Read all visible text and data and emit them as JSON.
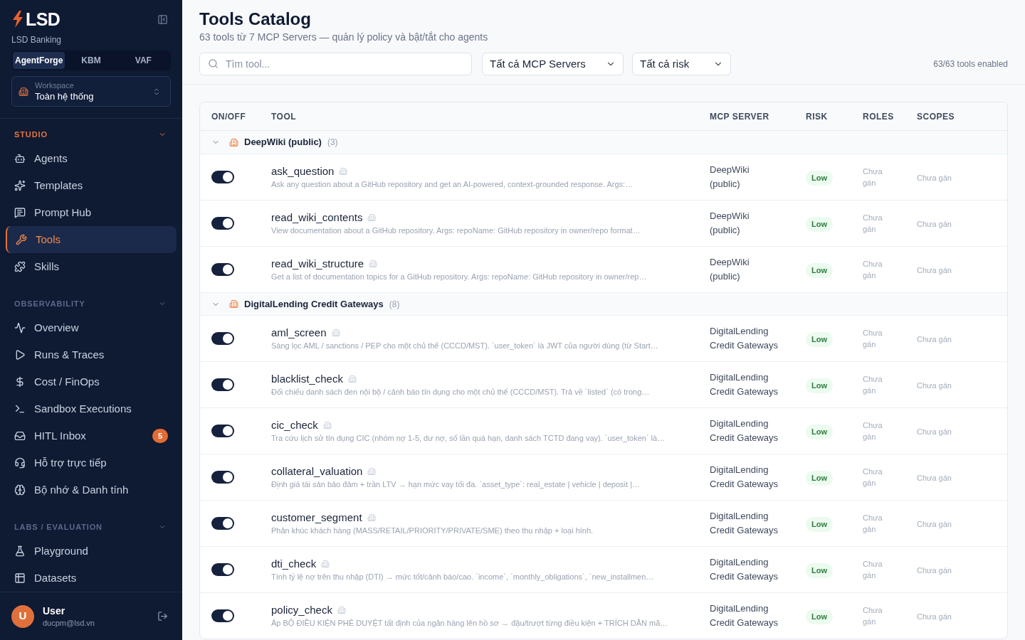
{
  "sidebar": {
    "logo": {
      "text": "LSD"
    },
    "org": "LSD Banking",
    "app_tabs": [
      {
        "label": "AgentForge",
        "selected": true
      },
      {
        "label": "KBM",
        "selected": false
      },
      {
        "label": "VAF",
        "selected": false
      }
    ],
    "workspace": {
      "label": "Workspace",
      "value": "Toàn hệ thống"
    },
    "sections": [
      {
        "title": "STUDIO",
        "active": true,
        "expanded": true,
        "items": [
          {
            "label": "Agents",
            "selected": false
          },
          {
            "label": "Templates",
            "selected": false
          },
          {
            "label": "Prompt Hub",
            "selected": false
          },
          {
            "label": "Tools",
            "selected": true
          },
          {
            "label": "Skills",
            "selected": false
          }
        ]
      },
      {
        "title": "OBSERVABILITY",
        "active": false,
        "expanded": true,
        "items": [
          {
            "label": "Overview",
            "selected": false
          },
          {
            "label": "Runs & Traces",
            "selected": false
          },
          {
            "label": "Cost / FinOps",
            "selected": false
          },
          {
            "label": "Sandbox Executions",
            "selected": false
          },
          {
            "label": "HITL Inbox",
            "selected": false,
            "badge": "5"
          },
          {
            "label": "Hỗ trợ trực tiếp",
            "selected": false
          },
          {
            "label": "Bộ nhớ & Danh tính",
            "selected": false
          }
        ]
      },
      {
        "title": "LABS / EVALUATION",
        "active": false,
        "expanded": true,
        "items": [
          {
            "label": "Playground",
            "selected": false
          },
          {
            "label": "Datasets",
            "selected": false
          }
        ]
      }
    ],
    "user": {
      "avatar": "U",
      "name": "User",
      "email": "ducpm@lsd.vn"
    }
  },
  "header": {
    "title": "Tools Catalog",
    "subtitle": "63 tools từ 7 MCP Servers — quản lý policy và bật/tắt cho agents"
  },
  "filters": {
    "search": {
      "placeholder": "Tìm tool..."
    },
    "dropdowns": [
      {
        "value": "Tất cả MCP Servers"
      },
      {
        "value": "Tất cả risk"
      }
    ],
    "summary": "63/63 tools enabled"
  },
  "table": {
    "columns": [
      "ON/OFF",
      "TOOL",
      "MCP SERVER",
      "RISK",
      "ROLES",
      "SCOPES"
    ],
    "groups": [
      {
        "name": "DeepWiki (public)",
        "count": "(3)",
        "expanded": true,
        "tools": [
          {
            "enabled": true,
            "name": "ask_question",
            "description": "Ask any question about a GitHub repository and get an AI-powered, context-grounded response. Args:…",
            "server": "DeepWiki (public)",
            "risk": {
              "label": "Low",
              "kind": "low"
            },
            "roles": "Chưa gán",
            "scopes": "Chưa gán"
          },
          {
            "enabled": true,
            "name": "read_wiki_contents",
            "description": "View documentation about a GitHub repository. Args: repoName: GitHub repository in owner/repo format…",
            "server": "DeepWiki (public)",
            "risk": {
              "label": "Low",
              "kind": "low"
            },
            "roles": "Chưa gán",
            "scopes": "Chưa gán"
          },
          {
            "enabled": true,
            "name": "read_wiki_structure",
            "description": "Get a list of documentation topics for a GitHub repository. Args: repoName: GitHub repository in owner/rep…",
            "server": "DeepWiki (public)",
            "risk": {
              "label": "Low",
              "kind": "low"
            },
            "roles": "Chưa gán",
            "scopes": "Chưa gán"
          }
        ]
      },
      {
        "name": "DigitalLending Credit Gateways",
        "count": "(8)",
        "expanded": true,
        "tools": [
          {
            "enabled": true,
            "name": "aml_screen",
            "description": "Sàng lọc AML / sanctions / PEP cho một chủ thể (CCCD/MST). `user_token` là JWT của người dùng (từ Start…",
            "server": "DigitalLending Credit Gateways",
            "risk": {
              "label": "Low",
              "kind": "low"
            },
            "roles": "Chưa gán",
            "scopes": "Chưa gán"
          },
          {
            "enabled": true,
            "name": "blacklist_check",
            "description": "Đối chiếu danh sách đen nội bộ / cảnh báo tín dụng cho một chủ thể (CCCD/MST). Trả về `listed` (có trong…",
            "server": "DigitalLending Credit Gateways",
            "risk": {
              "label": "Low",
              "kind": "low"
            },
            "roles": "Chưa gán",
            "scopes": "Chưa gán"
          },
          {
            "enabled": true,
            "name": "cic_check",
            "description": "Tra cứu lịch sử tín dụng CIC (nhóm nợ 1-5, dư nợ, số lần quá hạn, danh sách TCTD đang vay). `user_token` là…",
            "server": "DigitalLending Credit Gateways",
            "risk": {
              "label": "Low",
              "kind": "low"
            },
            "roles": "Chưa gán",
            "scopes": "Chưa gán"
          },
          {
            "enabled": true,
            "name": "collateral_valuation",
            "description": "Định giá tài sản bảo đảm + trần LTV → hạn mức vay tối đa. `asset_type`: real_estate | vehicle | deposit |…",
            "server": "DigitalLending Credit Gateways",
            "risk": {
              "label": "Low",
              "kind": "low"
            },
            "roles": "Chưa gán",
            "scopes": "Chưa gán"
          },
          {
            "enabled": true,
            "name": "customer_segment",
            "description": "Phân khúc khách hàng (MASS/RETAIL/PRIORITY/PRIVATE/SME) theo thu nhập + loại hình.",
            "server": "DigitalLending Credit Gateways",
            "risk": {
              "label": "Low",
              "kind": "low"
            },
            "roles": "Chưa gán",
            "scopes": "Chưa gán"
          },
          {
            "enabled": true,
            "name": "dti_check",
            "description": "Tính tỷ lệ nợ trên thu nhập (DTI) → mức tốt/cảnh báo/cao. `income`, `monthly_obligations`, `new_installmen…",
            "server": "DigitalLending Credit Gateways",
            "risk": {
              "label": "Low",
              "kind": "low"
            },
            "roles": "Chưa gán",
            "scopes": "Chưa gán"
          },
          {
            "enabled": true,
            "name": "policy_check",
            "description": "Áp BỘ ĐIỀU KIỆN PHÊ DUYỆT tất định của ngân hàng lên hồ sơ → đậu/trượt từng điều kiện + TRÍCH DẪN mã…",
            "server": "DigitalLending Credit Gateways",
            "risk": {
              "label": "Low",
              "kind": "low"
            },
            "roles": "Chưa gán",
            "scopes": "Chưa gán"
          }
        ]
      }
    ]
  }
}
